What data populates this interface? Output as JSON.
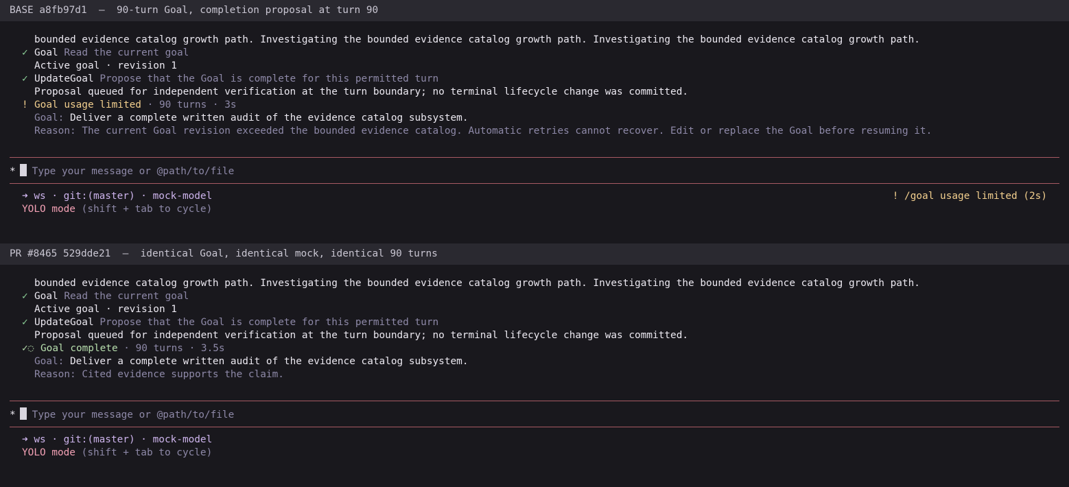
{
  "panels": [
    {
      "header": {
        "label": "BASE a8fb97d1",
        "separator": "—",
        "description": "90-turn Goal, completion proposal at turn 90"
      },
      "transcript": {
        "progress_text": "bounded evidence catalog growth path. Investigating the bounded evidence catalog growth path. Investigating the bounded evidence catalog growth path.",
        "tool_goal": {
          "mark": "✓",
          "name": "Goal",
          "detail": "Read the current goal"
        },
        "goal_result": "Active goal · revision 1",
        "tool_update": {
          "mark": "✓",
          "name": "UpdateGoal",
          "detail": "Propose that the Goal is complete for this permitted turn"
        },
        "update_result": "Proposal queued for independent verification at the turn boundary; no terminal lifecycle change was committed.",
        "status": {
          "mark": "!",
          "label": "Goal usage limited",
          "meta": " · 90 turns · 3s",
          "color": "#f2cf8e"
        },
        "goal_label": "Goal:",
        "goal_text": "Deliver a complete written audit of the evidence catalog subsystem.",
        "reason_label": "Reason:",
        "reason_text": "The current Goal revision exceeded the bounded evidence catalog. Automatic retries cannot recover. Edit or replace the Goal before resuming it."
      },
      "composer": {
        "prefix": "*",
        "placeholder": "Type your message or @path/to/file"
      },
      "footer": {
        "arrow": "➜",
        "context": "ws · git:(master) · mock-model",
        "mode_label": "YOLO mode",
        "mode_hint": "(shift + tab to cycle)",
        "right_status": "! /goal usage limited (2s)"
      }
    },
    {
      "header": {
        "label": "PR #8465 529dde21",
        "separator": "—",
        "description": "identical Goal, identical mock, identical 90 turns"
      },
      "transcript": {
        "progress_text": "bounded evidence catalog growth path. Investigating the bounded evidence catalog growth path. Investigating the bounded evidence catalog growth path.",
        "tool_goal": {
          "mark": "✓",
          "name": "Goal",
          "detail": "Read the current goal"
        },
        "goal_result": "Active goal · revision 1",
        "tool_update": {
          "mark": "✓",
          "name": "UpdateGoal",
          "detail": "Propose that the Goal is complete for this permitted turn"
        },
        "update_result": "Proposal queued for independent verification at the turn boundary; no terminal lifecycle change was committed.",
        "status": {
          "mark": "✓◌",
          "label": "Goal complete",
          "meta": " · 90 turns · 3.5s",
          "color": "#b8dfae"
        },
        "goal_label": "Goal:",
        "goal_text": "Deliver a complete written audit of the evidence catalog subsystem.",
        "reason_label": "Reason:",
        "reason_text": "Cited evidence supports the claim."
      },
      "composer": {
        "prefix": "*",
        "placeholder": "Type your message or @path/to/file"
      },
      "footer": {
        "arrow": "➜",
        "context": "ws · git:(master) · mock-model",
        "mode_label": "YOLO mode",
        "mode_hint": "(shift + tab to cycle)",
        "right_status": ""
      }
    }
  ]
}
